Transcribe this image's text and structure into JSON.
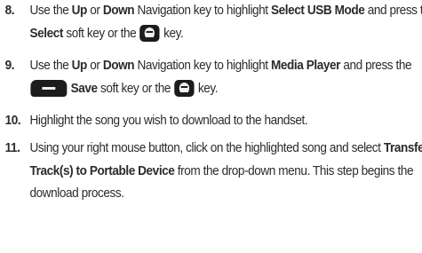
{
  "steps": [
    {
      "number": "8.",
      "p1": "Use the ",
      "b1": "Up",
      "p2": " or ",
      "b2": "Down",
      "p3": " Navigation key to highlight ",
      "b3": "Select USB Mode",
      "p4": " and press the ",
      "b4": "Select",
      "p5": " soft key or the ",
      "p6": " key."
    },
    {
      "number": "9.",
      "p1": "Use the ",
      "b1": "Up",
      "p2": " or ",
      "b2": "Down",
      "p3": " Navigation key to highlight ",
      "b3": "Media Player",
      "p4": " and press the ",
      "b4": "Save",
      "p5": " soft key or the ",
      "p6": " key."
    },
    {
      "number": "10.",
      "text": "Highlight the song you wish to download to the handset."
    },
    {
      "number": "11.",
      "p1": "Using your right mouse button, click on the highlighted song and select ",
      "b1": "Transfer Track(s) to Portable Device",
      "p2": " from the drop-down menu. This step begins the download process."
    }
  ],
  "icons": {
    "select_key": "select-key-icon",
    "soft_key": "left-soft-key-icon"
  }
}
